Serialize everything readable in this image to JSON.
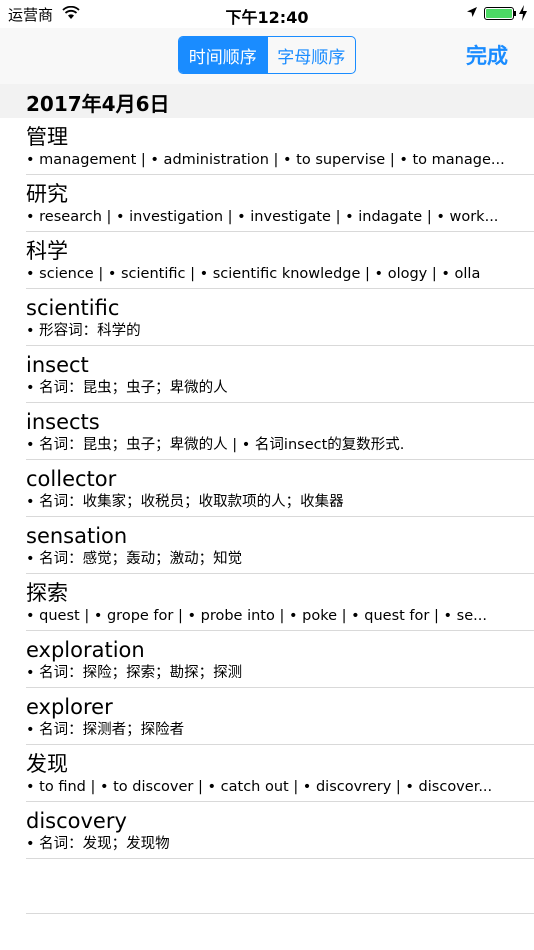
{
  "status_bar": {
    "carrier": "运营商",
    "time": "下午12:40"
  },
  "nav": {
    "segments": [
      "时间顺序",
      "字母顺序"
    ],
    "selected_segment": 0,
    "done_label": "完成",
    "accent_color": "#1a8cff"
  },
  "section": {
    "date": "2017年4月6日"
  },
  "entries": [
    {
      "word": "管理",
      "definition": "• management  | • administration  | • to supervise  | • to manage..."
    },
    {
      "word": "研究",
      "definition": "• research  | • investigation  | • investigate  | • indagate  | • work..."
    },
    {
      "word": "科学",
      "definition": "• science  | • scientific  | • scientific knowledge  | • ology  | • olla"
    },
    {
      "word": "scientific",
      "definition": "• 形容词：科学的"
    },
    {
      "word": "insect",
      "definition": "• 名词：昆虫；虫子；卑微的人"
    },
    {
      "word": "insects",
      "definition": "• 名词：昆虫；虫子；卑微的人  | • 名词insect的复数形式."
    },
    {
      "word": "collector",
      "definition": "• 名词：收集家；收税员；收取款项的人；收集器"
    },
    {
      "word": "sensation",
      "definition": "• 名词：感觉；轰动；激动；知觉"
    },
    {
      "word": "探索",
      "definition": "• quest  | • grope for  | • probe into  | • poke  | • quest for  | • se..."
    },
    {
      "word": "exploration",
      "definition": "• 名词：探险；探索；勘探；探测"
    },
    {
      "word": "explorer",
      "definition": "• 名词：探测者；探险者"
    },
    {
      "word": "发现",
      "definition": "• to find  | • to discover  | • catch out  | • discovrery  | • discover..."
    },
    {
      "word": "discovery",
      "definition": "• 名词：发现；发现物"
    }
  ]
}
